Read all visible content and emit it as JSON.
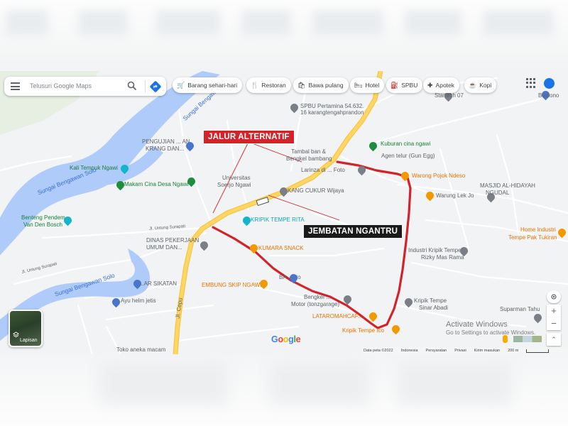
{
  "search": {
    "placeholder": "Telusuri Google Maps"
  },
  "chips": [
    {
      "icon": "cart-icon",
      "glyph": "🛒",
      "label": "Barang sehari-hari"
    },
    {
      "icon": "restaurant-icon",
      "glyph": "🍴",
      "label": "Restoran"
    },
    {
      "icon": "takeout-icon",
      "glyph": "🛍",
      "label": "Bawa pulang"
    },
    {
      "icon": "hotel-icon",
      "glyph": "🛏",
      "label": "Hotel"
    },
    {
      "icon": "fuel-icon",
      "glyph": "⛽",
      "label": "SPBU"
    },
    {
      "icon": "pharmacy-icon",
      "glyph": "✚",
      "label": "Apotek"
    },
    {
      "icon": "coffee-icon",
      "glyph": "☕",
      "label": "Kopi"
    }
  ],
  "callouts": {
    "alt_route": "JALUR ALTERNATIF",
    "bridge": "JEMBATAN NGANTRU"
  },
  "rivers": {
    "top": "Sungai Bengawan",
    "mid": "Sungai Bengawan Solo",
    "low": "Sungai Bengawan Solo"
  },
  "roads": {
    "cepu": "Jl. Cepu",
    "untung_surapati": "Jl. Untung Surapati",
    "untung_surapati_2": "Jl. Untung Surapati"
  },
  "places": {
    "startech": "Startech 07",
    "budiono": "Budiono",
    "spbu_line1": "SPBU Pertamina 54.632.",
    "spbu_line2": "16 karangtengahprandon",
    "kuburan": "Kuburan cina ngawi",
    "agen_telur": "Agen telur (Gun Egg)",
    "tambal_ban_1": "Tambal ban &",
    "tambal_ban_2": "Bengkel bambang",
    "larinza": "Larinza di ... Foto",
    "warong_pojok": "Warong Pojok Ndeso",
    "masjid_1": "MASJID AL-HIDAYAH",
    "masjid_2": "NGUDAL",
    "warung_lek": "Warung Lek Jo",
    "pengujian_1": "PENGUJIAN ... AN",
    "pengujian_2": "KRANG DAN...",
    "kali_tempuk": "Kali Tempuk Ngawi",
    "makam": "Makam Cina Desa Ngawi",
    "universitas_1": "Universitas",
    "universitas_2": "Soerjo Ngawi",
    "cukur": "KANG CUKUR Wijaya",
    "benteng_1": "Benteng Pendem",
    "benteng_2": "Van Den Bosch",
    "kripik_rita": "KRIPIK TEMPE RITA",
    "home_industri_1": "Home Industri",
    "home_industri_2": "Tempe Pak Tukiran",
    "dinas_1": "DINAS PEKERJAAN",
    "dinas_2": "UMUM DAN...",
    "kumara": "KUMARA SNACK",
    "industri_rizky_1": "Industri Kripik Tempe",
    "industri_rizky_2": "Rizky Mas Rama",
    "ba": "BA ... rto",
    "sikatan": "...AR SIKATAN",
    "embung": "EMBUNG SKIP NGAWI",
    "bengkel_1": "Bengkel ...",
    "bengkel_2": "Motor (tonzgarage)",
    "kripik_abadi_1": "Kripik Tempe",
    "kripik_abadi_2": "Sinar Abadi",
    "ayu_helm": "Ayu helm jetis",
    "lataromah": "LATAROMAHCAF...",
    "kripik_tempe_ico": "Kripik Tempe Ico",
    "suparman": "Suparman Tahu",
    "toko_aneka": "Toko aneka macam"
  },
  "watermark": {
    "line1": "Activate Windows",
    "line2": "Go to Settings to activate Windows."
  },
  "layer_button": {
    "label": "Lapisan"
  },
  "map_controls": {
    "zoom_in": "+",
    "zoom_out": "−"
  },
  "logo": {
    "text": "Google"
  },
  "footer": {
    "data": "Data peta ©2022",
    "region": "Indonesia",
    "terms": "Persyaratan",
    "privacy": "Privasi",
    "feedback": "Kirim masukan",
    "scale": "200 m"
  },
  "colors": {
    "route_red": "#d0232a",
    "river": "#aecbfa",
    "main_road": "#fdd663",
    "callout_red": "#d3232a"
  }
}
